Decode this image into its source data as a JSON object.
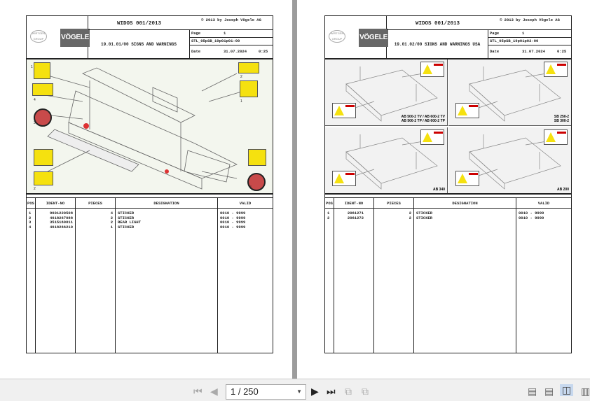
{
  "pages": [
    {
      "header": {
        "title": "WIDOS 001/2013",
        "copyright": "© 2013 by Joseph Vögele AG",
        "section": "19.01.01/00 SIGNS AND WARNINGS",
        "page_label": "Page",
        "page_value": "1",
        "doc_id": "STL_05pSB_19p01p01-00",
        "date_label": "Date",
        "date": "31.07.2024",
        "time": "0:25",
        "logo_wirtgen": "WIRTGEN GROUP",
        "logo_vogele": "VÖGELE"
      },
      "callouts": [
        "1",
        "2",
        "1",
        "3",
        "4",
        "2",
        "3"
      ],
      "table": {
        "headers": [
          "POS",
          "IDENT-NO",
          "PIECES",
          "DESIGNATION",
          "VALID"
        ],
        "rows": [
          [
            "1",
            "9601220508",
            "4",
            "STICKER",
            "0010 - 9999"
          ],
          [
            "2",
            "4618267088",
            "2",
            "STICKER",
            "0010 - 9999"
          ],
          [
            "3",
            "3515160011",
            "2",
            "REAR LIGHT",
            "0010 - 9999"
          ],
          [
            "4",
            "4618266210",
            "1",
            "STICKER",
            "0010 - 9999"
          ]
        ]
      }
    },
    {
      "header": {
        "title": "WIDOS 001/2013",
        "copyright": "© 2013 by Joseph Vögele AG",
        "section": "19.01.02/00 SIGNS AND WARNINGS USA",
        "page_label": "Page",
        "page_value": "1",
        "doc_id": "STL_05pSB_19p01p02-00",
        "date_label": "Date",
        "date": "31.07.2024",
        "time": "0:25",
        "logo_wirtgen": "WIRTGEN GROUP",
        "logo_vogele": "VÖGELE"
      },
      "panels": [
        {
          "model": "AB 500-2 TV / AB 600-2 TV",
          "model2": "AB 500-2 TP / AB 600-2 TP"
        },
        {
          "model": "SB 250-2",
          "model2": "SB 300-2"
        },
        {
          "model": "AB 340",
          "model2": ""
        },
        {
          "model": "AB 200",
          "model2": ""
        }
      ],
      "table": {
        "headers": [
          "POS",
          "IDENT-NO",
          "PIECES",
          "DESIGNATION",
          "VALID"
        ],
        "rows": [
          [
            "1",
            "2061271",
            "2",
            "STICKER",
            "0010 - 9999"
          ],
          [
            "2",
            "2061272",
            "2",
            "STICKER",
            "0010 - 9999"
          ]
        ]
      }
    }
  ],
  "toolbar": {
    "page_indicator": "1 / 250",
    "current_page": 1,
    "total_pages": 250
  }
}
